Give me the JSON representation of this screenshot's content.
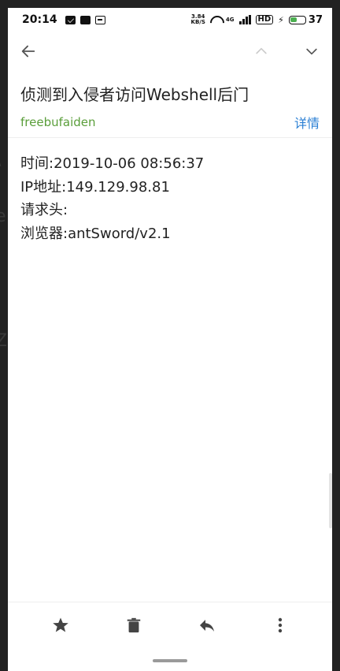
{
  "status_bar": {
    "time": "20:14",
    "net_speed_value": "3.84",
    "net_speed_unit": "KB/S",
    "network_type": "4G",
    "hd_label": "HD",
    "battery_level": "37"
  },
  "header": {
    "back_icon": "arrow-left-icon",
    "prev_icon": "chevron-up-icon",
    "next_icon": "chevron-down-icon"
  },
  "email": {
    "subject": "侦测到入侵者访问Webshell后门",
    "sender": "freebufaiden",
    "details_label": "详情",
    "body_lines": [
      "时间:2019-10-06 08:56:37",
      "IP地址:149.129.98.81",
      "请求头:",
      "浏览器:antSword/v2.1"
    ]
  },
  "bottom_bar": {
    "star_icon": "star-icon",
    "delete_icon": "trash-icon",
    "reply_icon": "reply-icon",
    "more_icon": "more-vert-icon"
  },
  "colors": {
    "sender": "#5a9e3a",
    "link": "#2a7fd4",
    "text": "#222222",
    "battery": "#4caf50"
  }
}
